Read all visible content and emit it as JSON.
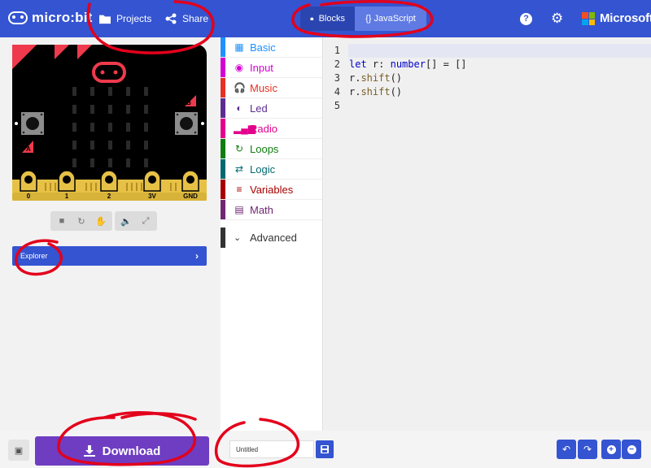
{
  "header": {
    "logo_text": "micro:bit",
    "projects_label": "Projects",
    "share_label": "Share",
    "blocks_label": "Blocks",
    "javascript_label": "{} JavaScript",
    "help_glyph": "?",
    "microsoft_label": "Microsoft",
    "active_editor": "JavaScript",
    "icons": [
      "folder-icon",
      "share-icon",
      "puzzle-icon",
      "help-icon",
      "gear-icon",
      "microsoft-logo"
    ]
  },
  "simulator": {
    "button_a": "A",
    "button_b": "B",
    "pins": [
      "0",
      "1",
      "2",
      "3V",
      "GND"
    ],
    "controls": [
      "stop-icon",
      "restart-icon",
      "debug-icon",
      "mute-icon",
      "fullscreen-icon"
    ],
    "explorer_label": "Explorer"
  },
  "toolbox": {
    "categories": [
      {
        "label": "Basic",
        "color": "#1e90ff",
        "icon": "grid-icon"
      },
      {
        "label": "Input",
        "color": "#d400d4",
        "icon": "target-icon"
      },
      {
        "label": "Music",
        "color": "#e63022",
        "icon": "headphones-icon"
      },
      {
        "label": "Led",
        "color": "#5c2d91",
        "icon": "toggle-icon"
      },
      {
        "label": "Radio",
        "color": "#e3008c",
        "icon": "signal-icon"
      },
      {
        "label": "Loops",
        "color": "#107c10",
        "icon": "loop-icon"
      },
      {
        "label": "Logic",
        "color": "#006970",
        "icon": "shuffle-icon"
      },
      {
        "label": "Variables",
        "color": "#a80000",
        "icon": "list-icon"
      },
      {
        "label": "Math",
        "color": "#712672",
        "icon": "calculator-icon"
      }
    ],
    "advanced_label": "Advanced"
  },
  "editor": {
    "lines": [
      {
        "num": "1",
        "text": ""
      },
      {
        "num": "2",
        "text": "let r: number[] = []"
      },
      {
        "num": "3",
        "text": "r.shift()"
      },
      {
        "num": "4",
        "text": "r.shift()"
      },
      {
        "num": "5",
        "text": ""
      }
    ]
  },
  "footer": {
    "download_label": "Download",
    "project_name_value": "Untitled",
    "icons": [
      "collapse-icon",
      "download-icon",
      "save-icon",
      "undo-icon",
      "redo-icon",
      "zoom-in-icon",
      "zoom-out-icon"
    ]
  },
  "colors": {
    "brand_blue": "#3454d1",
    "download_purple": "#6f3dc2",
    "annotation_red": "#e3001b"
  }
}
